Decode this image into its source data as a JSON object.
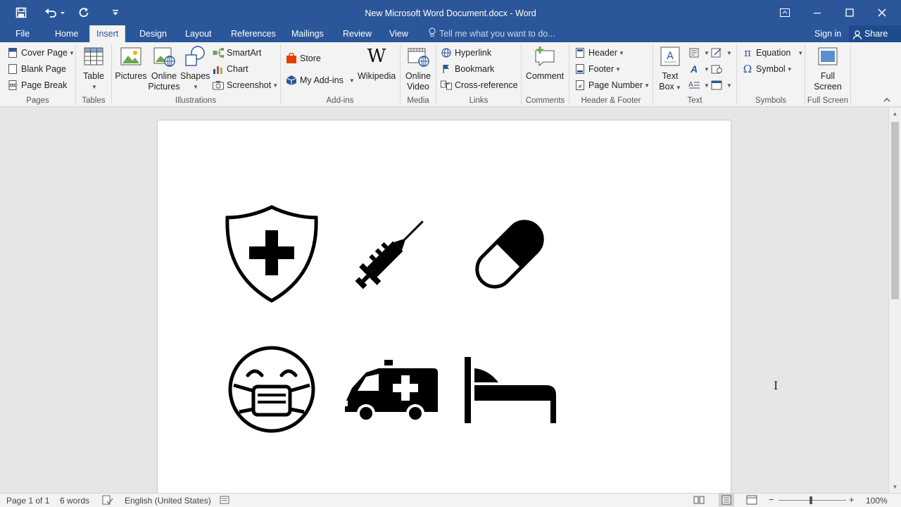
{
  "window": {
    "title": "New Microsoft Word Document.docx - Word",
    "accent": "#2b579a"
  },
  "quick_access": {
    "icons": [
      "save-icon",
      "undo-icon",
      "redo-icon",
      "customize-icon"
    ]
  },
  "tabs": [
    {
      "label": "File"
    },
    {
      "label": "Home"
    },
    {
      "label": "Insert",
      "active": true
    },
    {
      "label": "Design"
    },
    {
      "label": "Layout"
    },
    {
      "label": "References"
    },
    {
      "label": "Mailings"
    },
    {
      "label": "Review"
    },
    {
      "label": "View"
    }
  ],
  "tell_me": "Tell me what you want to do...",
  "account": {
    "sign_in": "Sign in",
    "share": "Share"
  },
  "ribbon": {
    "pages": {
      "label": "Pages",
      "cover_page": "Cover Page",
      "blank_page": "Blank Page",
      "page_break": "Page Break"
    },
    "tables": {
      "label": "Tables",
      "table": "Table"
    },
    "illustrations": {
      "label": "Illustrations",
      "pictures": "Pictures",
      "online_pictures_1": "Online",
      "online_pictures_2": "Pictures",
      "shapes": "Shapes",
      "smartart": "SmartArt",
      "chart": "Chart",
      "screenshot": "Screenshot"
    },
    "addins": {
      "label": "Add-ins",
      "store": "Store",
      "my_addins": "My Add-ins",
      "wikipedia": "Wikipedia"
    },
    "media": {
      "label": "Media",
      "online_video_1": "Online",
      "online_video_2": "Video"
    },
    "links": {
      "label": "Links",
      "hyperlink": "Hyperlink",
      "bookmark": "Bookmark",
      "cross_reference": "Cross-reference"
    },
    "comments": {
      "label": "Comments",
      "comment": "Comment"
    },
    "header_footer": {
      "label": "Header & Footer",
      "header": "Header",
      "footer": "Footer",
      "page_number": "Page Number"
    },
    "text": {
      "label": "Text",
      "text_box_1": "Text",
      "text_box_2": "Box"
    },
    "symbols": {
      "label": "Symbols",
      "equation": "Equation",
      "symbol": "Symbol"
    },
    "full_screen": {
      "label": "Full Screen",
      "btn_1": "Full",
      "btn_2": "Screen"
    }
  },
  "document": {
    "icons": [
      "shield-plus-icon",
      "syringe-icon",
      "pill-icon",
      "face-mask-icon",
      "ambulance-icon",
      "hospital-bed-icon"
    ]
  },
  "status": {
    "page": "Page 1 of 1",
    "words": "6 words",
    "language": "English (United States)",
    "zoom": "100%"
  }
}
